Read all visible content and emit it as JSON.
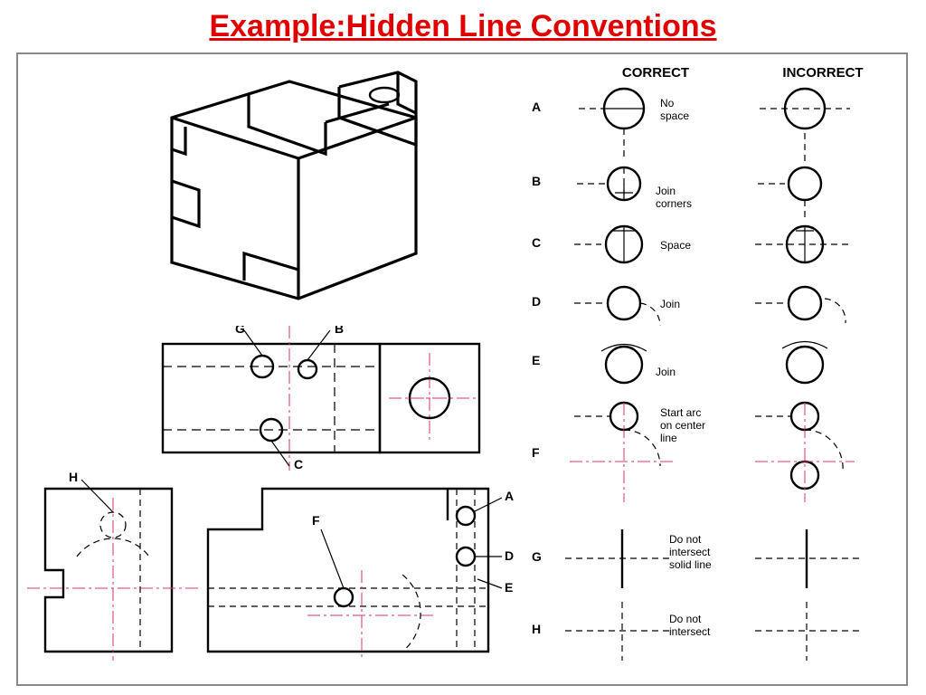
{
  "title": "Example:Hidden Line Conventions",
  "columns": {
    "correct": "CORRECT",
    "incorrect": "INCORRECT"
  },
  "rows": [
    {
      "letter": "A",
      "note": "No space"
    },
    {
      "letter": "B",
      "note": "Join corners"
    },
    {
      "letter": "C",
      "note": "Space"
    },
    {
      "letter": "D",
      "note": "Join"
    },
    {
      "letter": "E",
      "note": "Join"
    },
    {
      "letter": "F",
      "note": "Start arc on center line"
    },
    {
      "letter": "G",
      "note": "Do not intersect solid line"
    },
    {
      "letter": "H",
      "note": "Do not intersect"
    }
  ],
  "callouts": [
    "A",
    "B",
    "C",
    "D",
    "E",
    "F",
    "G",
    "H"
  ]
}
